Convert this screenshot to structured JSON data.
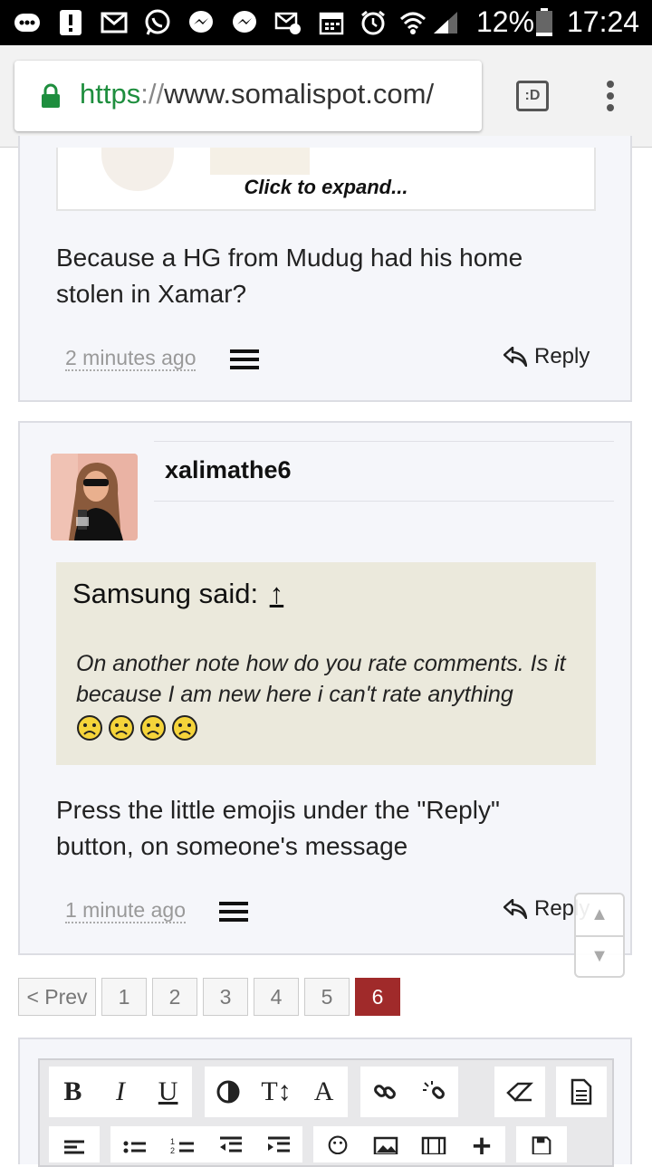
{
  "status_bar": {
    "battery_percent": "12%",
    "time": "17:24"
  },
  "browser": {
    "url_scheme": "https",
    "url_sep": "://",
    "url_host": "www.somalispot.com/",
    "tab_icon_label": ":D"
  },
  "quote_top": {
    "expand_label": "Click to expand..."
  },
  "post1": {
    "body": "Because a HG from Mudug had his home stolen in Xamar?",
    "time": "2 minutes ago",
    "reply_label": "Reply"
  },
  "post2": {
    "username": "xalimathe6",
    "quote_author": "Samsung said:",
    "quote_arrow": "↑",
    "quote_text": "On another note how do you rate comments. Is it because I am new here i can't rate anything",
    "body": "Press the little emojis under the \"Reply\" button, on someone's message",
    "time": "1 minute ago",
    "reply_label": "Reply"
  },
  "pagination": {
    "prev": "< Prev",
    "pages": [
      "1",
      "2",
      "3",
      "4",
      "5",
      "6"
    ],
    "current": "6"
  },
  "editor": {
    "bold": "B",
    "italic": "I",
    "underline": "U",
    "font_size": "T↕",
    "font_color": "A"
  },
  "colors": {
    "accent": "#a02a2a",
    "quote_bg": "#ebe9dc",
    "post_bg": "#f5f6fa",
    "secure_green": "#1e8e3e"
  }
}
